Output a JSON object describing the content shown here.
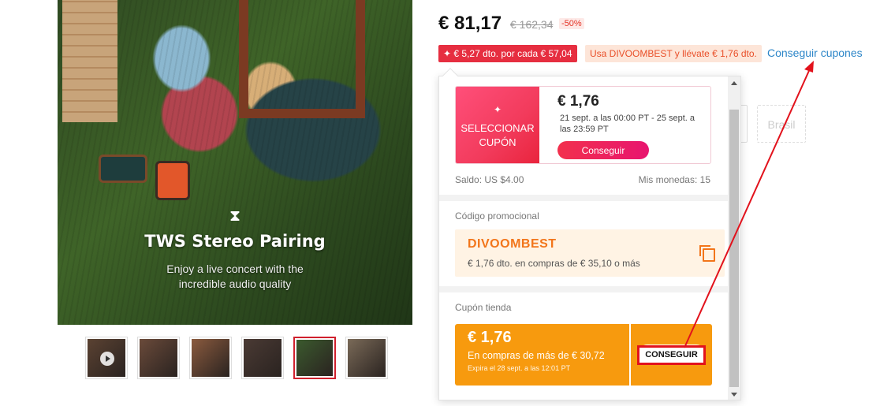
{
  "product_image": {
    "caption_title": "TWS Stereo Pairing",
    "caption_sub": "Enjoy a live concert with the incredible audio quality",
    "caption_icon": "hourglass-icon"
  },
  "thumbnails": [
    {
      "id": "video",
      "has_play": true,
      "color": "#5b4232"
    },
    {
      "id": "t2",
      "has_play": false,
      "color": "#6a4a3a"
    },
    {
      "id": "t3",
      "has_play": false,
      "color": "#8a5a3e"
    },
    {
      "id": "t4",
      "has_play": false,
      "color": "#4a3a34"
    },
    {
      "id": "t5",
      "has_play": false,
      "color": "#3b5a2e",
      "active": true
    },
    {
      "id": "t6",
      "has_play": false,
      "color": "#7a6a58"
    }
  ],
  "pricing": {
    "price": "€ 81,17",
    "old_price": "€ 162,34",
    "discount": "-50%"
  },
  "promo_tags": {
    "red_tag": "✦ € 5,27 dto. por cada € 57,04",
    "orange_tag": "Usa DIVOOMBEST y llévate € 1,76 dto.",
    "get_coupons_link": "Conseguir cupones"
  },
  "ghost_label": "Brasil",
  "dropdown": {
    "coupon": {
      "sparkle": "✦",
      "select_label": "SELECCIONAR CUPÓN",
      "amount": "€ 1,76",
      "validity": "21 sept. a las 00:00 PT - 25 sept. a las 23:59 PT",
      "button": "Conseguir"
    },
    "balance": "Saldo: US $4.00",
    "coins": "Mis monedas: 15",
    "promo_code_section": {
      "title": "Código promocional",
      "code": "DIVOOMBEST",
      "description": "€ 1,76 dto. en compras de € 35,10 o más"
    },
    "store_coupon_section": {
      "title": "Cupón tienda",
      "amount": "€ 1,76",
      "condition": "En compras de más de € 30,72",
      "expiry": "Expira el 28 sept. a las 12:01 PT",
      "button": "CONSEGUIR"
    }
  },
  "colors": {
    "accent_red": "#e62e40",
    "coupon_orange": "#f79a0e",
    "link_blue": "#2d86c8",
    "annotation_red": "#e2121c"
  }
}
